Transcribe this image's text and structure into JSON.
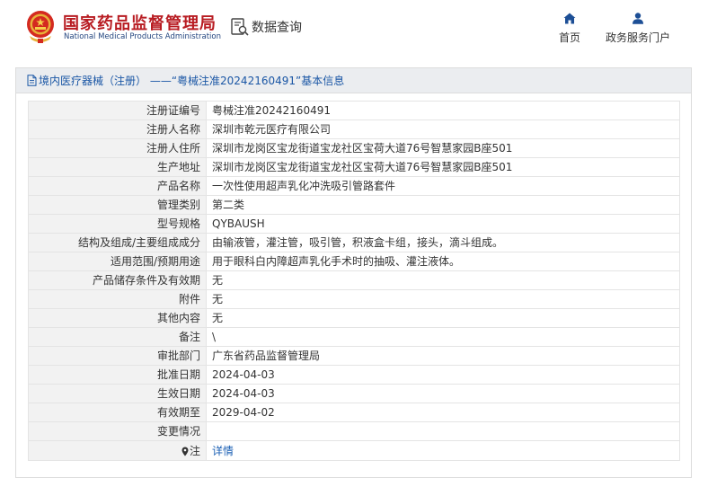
{
  "header": {
    "org_name_cn": "国家药品监督管理局",
    "org_name_en": "National Medical Products Administration",
    "data_query_label": "数据查询",
    "nav": {
      "home_label": "首页",
      "portal_label": "政务服务门户"
    }
  },
  "card": {
    "title": "境内医疗器械（注册） ——“粤械注准20242160491”基本信息"
  },
  "rows": [
    {
      "label": "注册证编号",
      "value": "粤械注准20242160491"
    },
    {
      "label": "注册人名称",
      "value": "深圳市乾元医疗有限公司"
    },
    {
      "label": "注册人住所",
      "value": "深圳市龙岗区宝龙街道宝龙社区宝荷大道76号智慧家园B座501"
    },
    {
      "label": "生产地址",
      "value": "深圳市龙岗区宝龙街道宝龙社区宝荷大道76号智慧家园B座501"
    },
    {
      "label": "产品名称",
      "value": "一次性使用超声乳化冲洗吸引管路套件"
    },
    {
      "label": "管理类别",
      "value": "第二类"
    },
    {
      "label": "型号规格",
      "value": "QYBAUSH"
    },
    {
      "label": "结构及组成/主要组成成分",
      "value": "由输液管，灌注管，吸引管，积液盒卡组，接头，滴斗组成。"
    },
    {
      "label": "适用范围/预期用途",
      "value": "用于眼科白内障超声乳化手术时的抽吸、灌注液体。"
    },
    {
      "label": "产品储存条件及有效期",
      "value": "无"
    },
    {
      "label": "附件",
      "value": "无"
    },
    {
      "label": "其他内容",
      "value": "无"
    },
    {
      "label": "备注",
      "value": "\\"
    },
    {
      "label": "审批部门",
      "value": "广东省药品监督管理局"
    },
    {
      "label": "批准日期",
      "value": "2024-04-03"
    },
    {
      "label": "生效日期",
      "value": "2024-04-03"
    },
    {
      "label": "有效期至",
      "value": "2029-04-02"
    },
    {
      "label": "变更情况",
      "value": ""
    }
  ],
  "note_row": {
    "label": "注",
    "link_text": "详情"
  },
  "colors": {
    "brand_red": "#b81c22",
    "link_blue": "#1a5fb4",
    "title_blue": "#1a56a5",
    "label_bg": "#f2f2f2"
  },
  "icons": {
    "emblem": "national-emblem-icon",
    "data_query": "search-document-icon",
    "home": "home-icon",
    "portal": "user-icon",
    "title": "document-icon",
    "note": "map-pin-icon"
  }
}
